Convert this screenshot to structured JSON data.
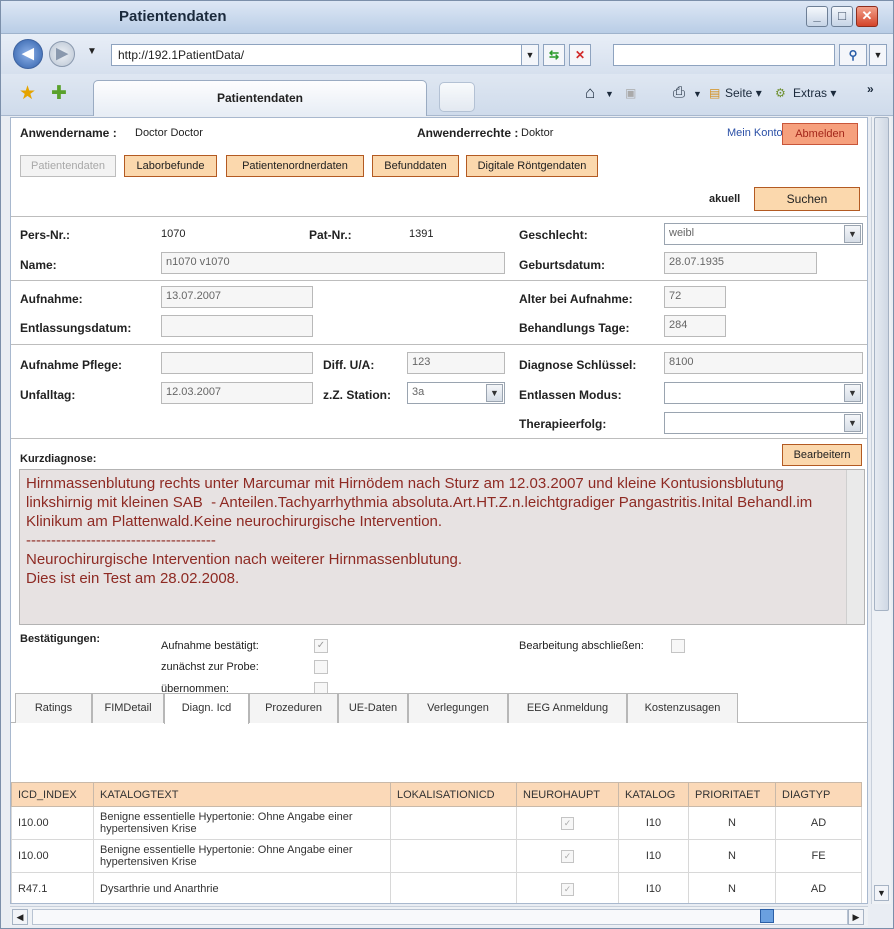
{
  "window": {
    "title": "Patientendaten"
  },
  "browser": {
    "url": "http://192.1PatientData/",
    "tab_title": "Patientendaten",
    "toolbar": {
      "page_label": "Seite",
      "extras_label": "Extras"
    }
  },
  "header": {
    "user_label": "Anwendername :",
    "user_value": "Doctor Doctor",
    "rights_label": "Anwenderrechte :",
    "rights_value": "Doktor",
    "account_link": "Mein Konto",
    "logout_button": "Abmelden"
  },
  "nav_buttons": [
    "Patientendaten",
    "Laborbefunde",
    "Patientenordnerdaten",
    "Befunddaten",
    "Digitale Röntgendaten"
  ],
  "search": {
    "label": "akuell",
    "button": "Suchen"
  },
  "form": {
    "pers_nr": {
      "label": "Pers-Nr.:",
      "value": "1070"
    },
    "pat_nr": {
      "label": "Pat-Nr.:",
      "value": "1391"
    },
    "geschlecht": {
      "label": "Geschlecht:",
      "value": "weibl"
    },
    "name": {
      "label": "Name:",
      "value": "n1070 v1070"
    },
    "geburtsdatum": {
      "label": "Geburtsdatum:",
      "value": "28.07.1935"
    },
    "aufnahme": {
      "label": "Aufnahme:",
      "value": "13.07.2007"
    },
    "alter": {
      "label": "Alter bei Aufnahme:",
      "value": "72"
    },
    "entlassungsdatum": {
      "label": "Entlassungsdatum:",
      "value": ""
    },
    "behandlungstage": {
      "label": "Behandlungs Tage:",
      "value": "284"
    },
    "aufnahme_pflege": {
      "label": "Aufnahme Pflege:",
      "value": ""
    },
    "diff_ua": {
      "label": "Diff. U/A:",
      "value": "123"
    },
    "diagnose_schluessel": {
      "label": "Diagnose Schlüssel:",
      "value": "8100"
    },
    "unfalltag": {
      "label": "Unfalltag:",
      "value": "12.03.2007"
    },
    "station": {
      "label": "z.Z. Station:",
      "value": "3a"
    },
    "entlassen_modus": {
      "label": "Entlassen Modus:",
      "value": ""
    },
    "therapieerfolg": {
      "label": "Therapieerfolg:",
      "value": ""
    }
  },
  "kurzdiagnose": {
    "label": "Kurzdiagnose:",
    "edit_button": "Bearbeitern",
    "text": "Hirnmassenblutung rechts unter Marcumar mit Hirnödem nach Sturz am 12.03.2007 und kleine Kontusionsblutung linkshirnig mit kleinen SAB  - Anteilen.Tachyarrhythmia absoluta.Art.HT.Z.n.leichtgradiger Pangastritis.Inital Behandl.im Klinikum am Plattenwald.Keine neurochirurgische Intervention.\n--------------------------------------\nNeurochirurgische Intervention nach weiterer Hirnmassenblutung.\nDies ist ein Test am 28.02.2008."
  },
  "bestaetigungen": {
    "label": "Bestätigungen:",
    "items": [
      {
        "label": "Aufnahme bestätigt:",
        "checked": true
      },
      {
        "label": "zunächst zur Probe:",
        "checked": false
      },
      {
        "label": "übernommen:",
        "checked": false
      }
    ],
    "abschliessen": {
      "label": "Bearbeitung abschließen:",
      "checked": false
    }
  },
  "tabs": [
    "Ratings",
    "FIMDetail",
    "Diagn. Icd",
    "Prozeduren",
    "UE-Daten",
    "Verlegungen",
    "EEG Anmeldung",
    "Kostenzusagen"
  ],
  "active_tab": "Diagn. Icd",
  "table": {
    "columns": [
      "ICD_INDEX",
      "KATALOGTEXT",
      "LOKALISATIONICD",
      "NEUROHAUPT",
      "KATALOG",
      "PRIORITAET",
      "DIAGTYP"
    ],
    "rows": [
      {
        "icd": "I10.00",
        "text": "Benigne essentielle Hypertonie: Ohne Angabe einer hypertensiven Krise",
        "lok": "",
        "neuro": true,
        "katalog": "I10",
        "prio": "N",
        "typ": "AD"
      },
      {
        "icd": "I10.00",
        "text": "Benigne essentielle Hypertonie: Ohne Angabe einer hypertensiven Krise",
        "lok": "",
        "neuro": true,
        "katalog": "I10",
        "prio": "N",
        "typ": "FE"
      },
      {
        "icd": "R47.1",
        "text": "Dysarthrie und Anarthrie",
        "lok": "",
        "neuro": true,
        "katalog": "I10",
        "prio": "N",
        "typ": "AD"
      }
    ]
  },
  "colors": {
    "accent_button": "#fbd8ad",
    "logout": "#f6a07d",
    "header_row": "#fbd9b8",
    "diagnosis_text": "#8e2a23"
  }
}
